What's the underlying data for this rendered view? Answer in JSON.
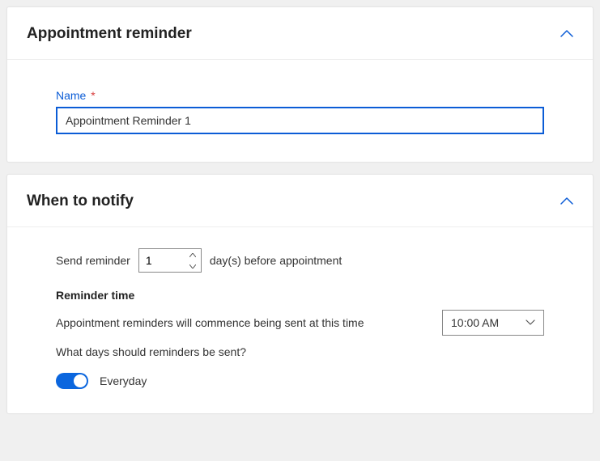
{
  "panels": {
    "appointment": {
      "title": "Appointment reminder",
      "name_field": {
        "label": "Name",
        "required_mark": "*",
        "value": "Appointment Reminder 1"
      }
    },
    "when": {
      "title": "When to notify",
      "send_prefix": "Send reminder",
      "days_value": "1",
      "send_suffix": "day(s) before appointment",
      "reminder_time_heading": "Reminder time",
      "reminder_time_desc": "Appointment reminders will commence being sent at this time",
      "time_value": "10:00 AM",
      "days_question": "What days should reminders be sent?",
      "toggle": {
        "on": true,
        "label": "Everyday"
      }
    }
  },
  "colors": {
    "primary": "#0b5cd6",
    "toggle": "#0b66de"
  }
}
